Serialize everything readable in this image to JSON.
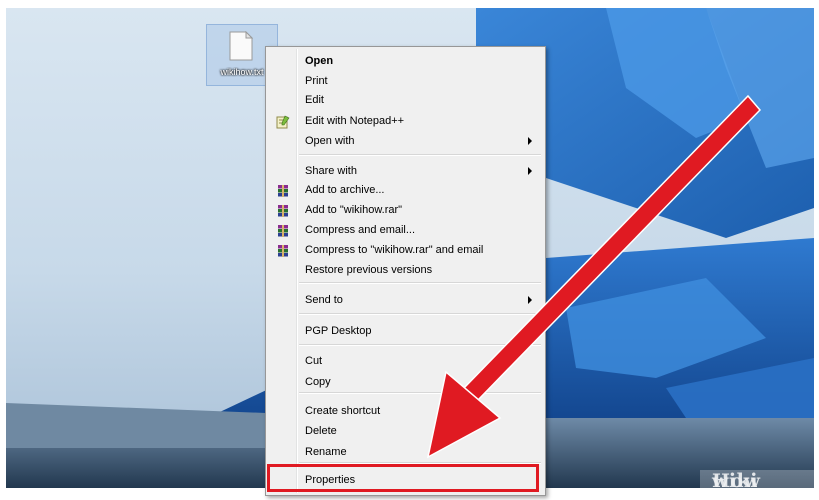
{
  "file": {
    "name": "wikihow.txt"
  },
  "context_menu": {
    "items": [
      {
        "label": "Open",
        "bold": true,
        "icon": "",
        "submenu": false
      },
      {
        "label": "Print",
        "bold": false,
        "icon": "",
        "submenu": false
      },
      {
        "label": "Edit",
        "bold": false,
        "icon": "",
        "submenu": false
      },
      {
        "label": "Edit with Notepad++",
        "bold": false,
        "icon": "notepad-plus-plus-icon",
        "submenu": false
      },
      {
        "label": "Open with",
        "bold": false,
        "icon": "",
        "submenu": true
      },
      {
        "label": "Share with",
        "bold": false,
        "icon": "",
        "submenu": true
      },
      {
        "label": "Add to archive...",
        "bold": false,
        "icon": "winrar-icon",
        "submenu": false
      },
      {
        "label": "Add to \"wikihow.rar\"",
        "bold": false,
        "icon": "winrar-icon",
        "submenu": false
      },
      {
        "label": "Compress and email...",
        "bold": false,
        "icon": "winrar-icon",
        "submenu": false
      },
      {
        "label": "Compress to \"wikihow.rar\" and email",
        "bold": false,
        "icon": "winrar-icon",
        "submenu": false
      },
      {
        "label": "Restore previous versions",
        "bold": false,
        "icon": "",
        "submenu": false
      },
      {
        "label": "Send to",
        "bold": false,
        "icon": "",
        "submenu": true
      },
      {
        "label": "PGP Desktop",
        "bold": false,
        "icon": "",
        "submenu": true
      },
      {
        "label": "Cut",
        "bold": false,
        "icon": "",
        "submenu": false
      },
      {
        "label": "Copy",
        "bold": false,
        "icon": "",
        "submenu": false
      },
      {
        "label": "Create shortcut",
        "bold": false,
        "icon": "",
        "submenu": false
      },
      {
        "label": "Delete",
        "bold": false,
        "icon": "",
        "submenu": false
      },
      {
        "label": "Rename",
        "bold": false,
        "icon": "",
        "submenu": false
      },
      {
        "label": "Properties",
        "bold": false,
        "icon": "",
        "submenu": false
      }
    ]
  },
  "annotation": {
    "highlight_color": "#e01a22",
    "arrow_color": "#e01a22",
    "target": "Properties"
  },
  "watermark": {
    "part1": "wiki",
    "part2": "How"
  }
}
